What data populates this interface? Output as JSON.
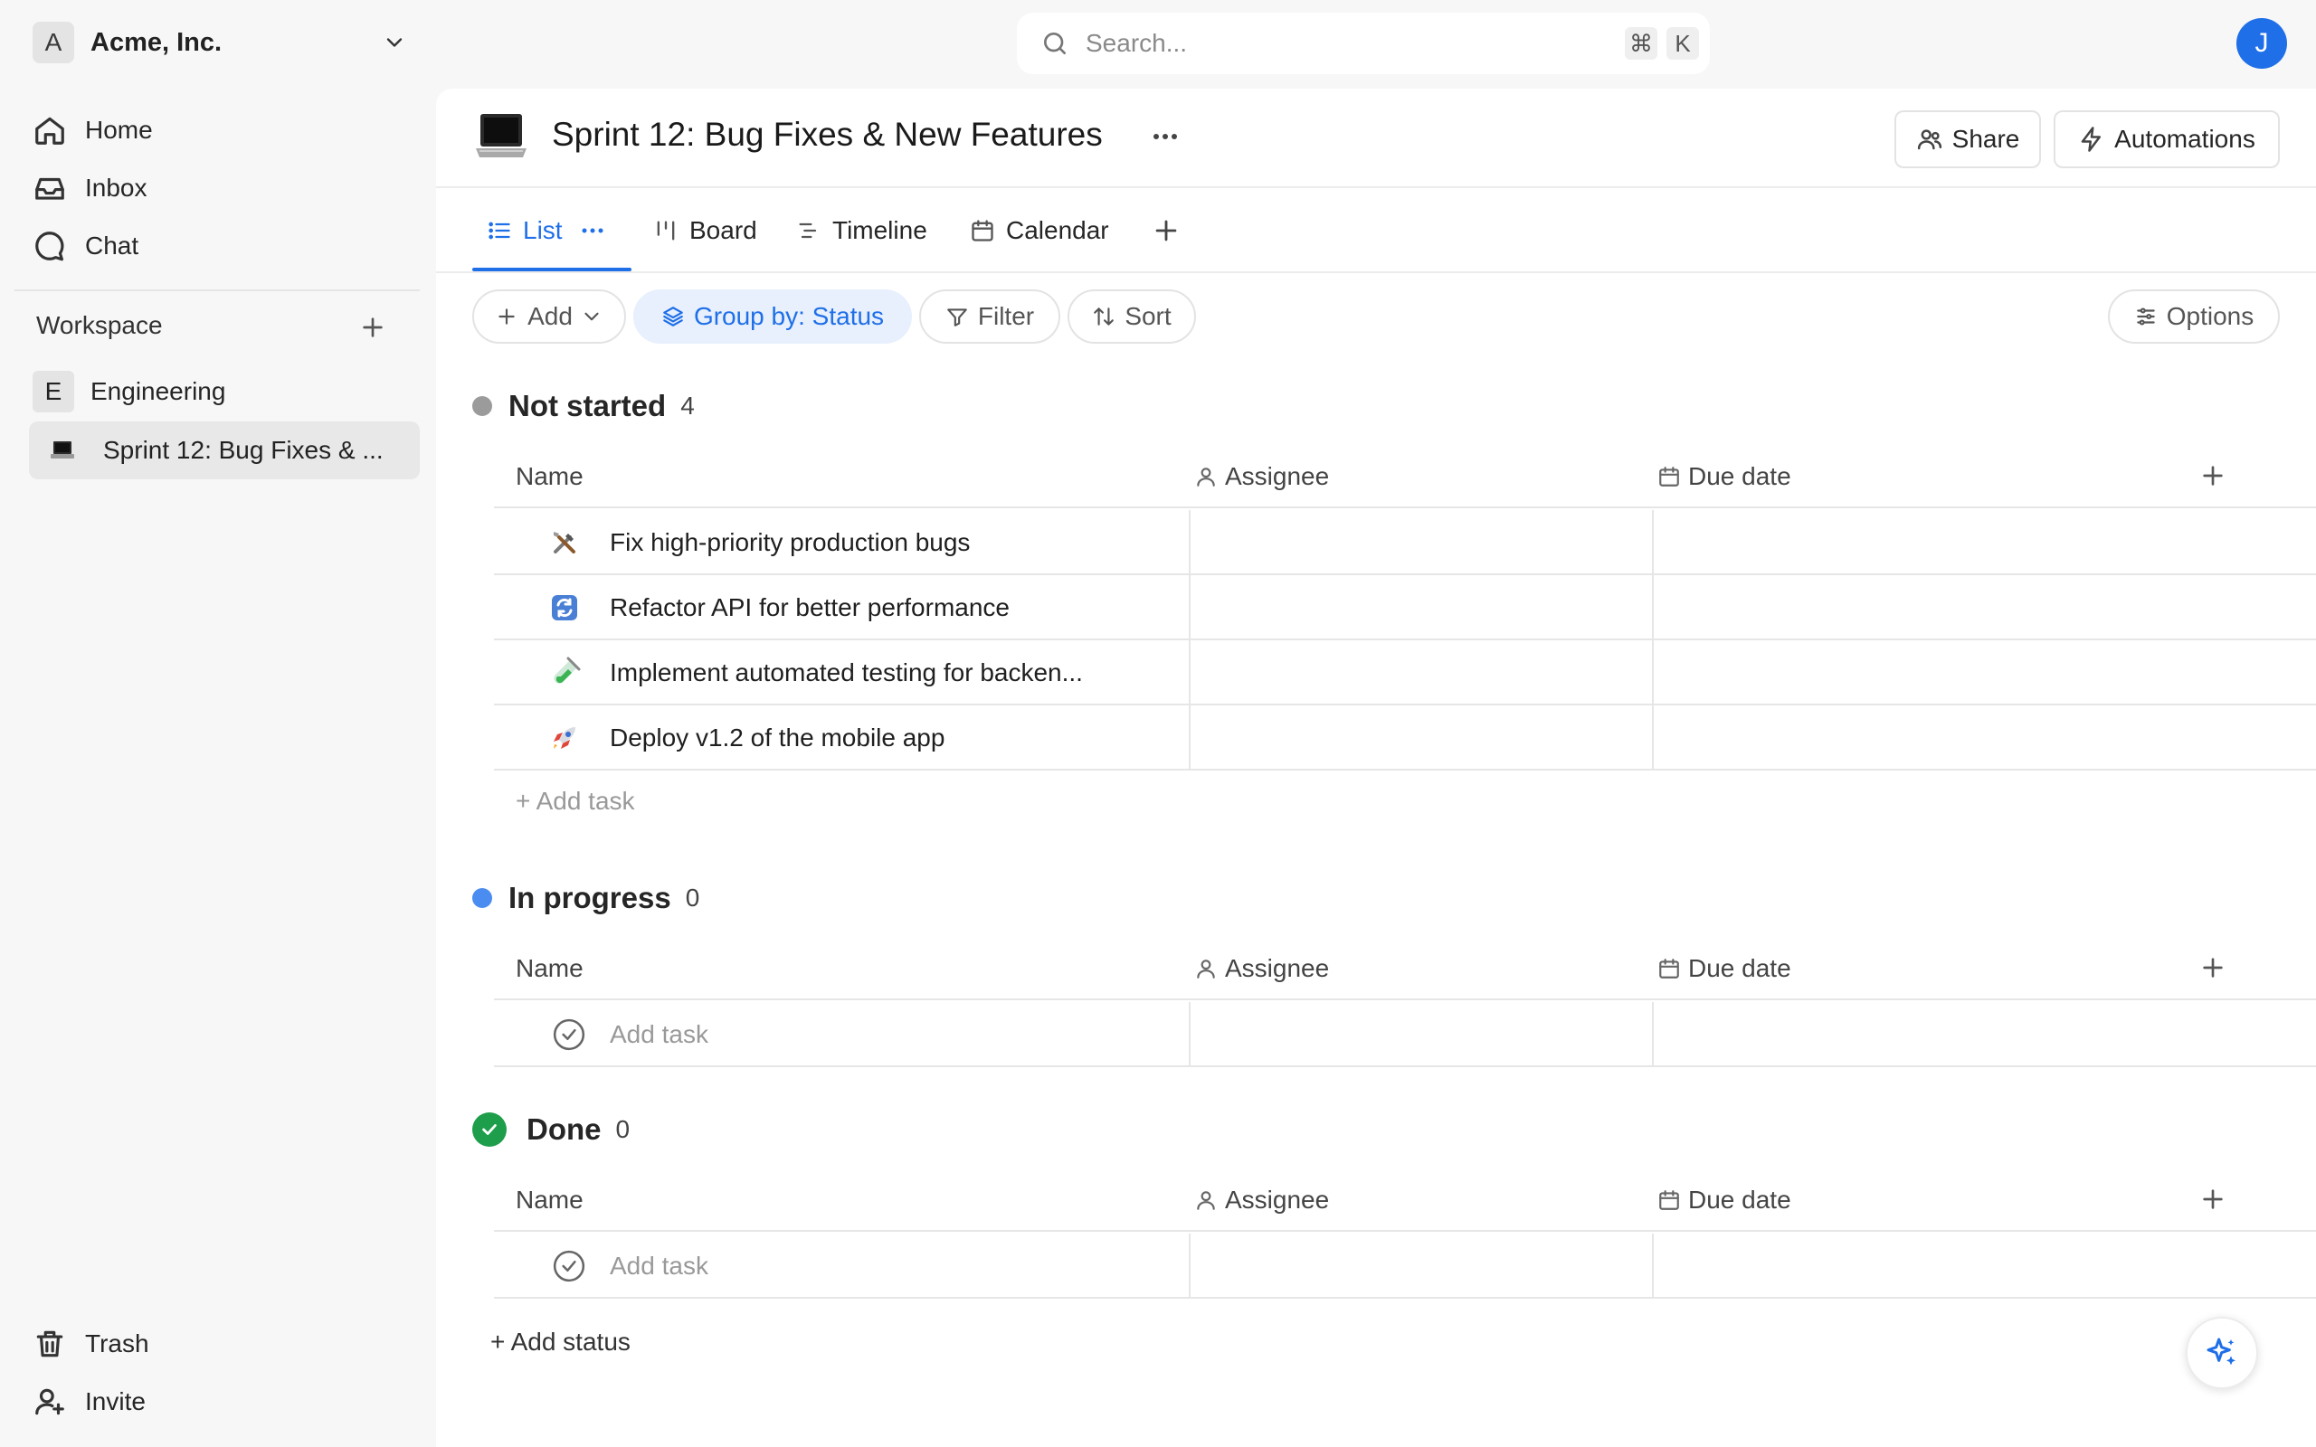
{
  "org": {
    "initial": "A",
    "name": "Acme, Inc."
  },
  "nav": [
    {
      "label": "Home",
      "icon": "home-icon"
    },
    {
      "label": "Inbox",
      "icon": "inbox-icon"
    },
    {
      "label": "Chat",
      "icon": "chat-icon"
    }
  ],
  "workspace": {
    "label": "Workspace",
    "team": {
      "initial": "E",
      "name": "Engineering"
    },
    "project": "Sprint 12: Bug Fixes & ..."
  },
  "sidebar_bottom": {
    "trash": "Trash",
    "invite": "Invite"
  },
  "search": {
    "placeholder": "Search...",
    "shortcut_cmd": "⌘",
    "shortcut_key": "K"
  },
  "user": {
    "initial": "J"
  },
  "page": {
    "title": "Sprint 12: Bug Fixes & New Features",
    "share": "Share",
    "automations": "Automations"
  },
  "tabs": [
    {
      "label": "List",
      "active": true
    },
    {
      "label": "Board"
    },
    {
      "label": "Timeline"
    },
    {
      "label": "Calendar"
    }
  ],
  "toolbar": {
    "add": "Add",
    "group_by": "Group by: Status",
    "filter": "Filter",
    "sort": "Sort",
    "options": "Options"
  },
  "columns": {
    "name": "Name",
    "assignee": "Assignee",
    "due_date": "Due date"
  },
  "groups": [
    {
      "status": "Not started",
      "count": "4",
      "color": "#9b9b9b",
      "tasks": [
        {
          "emoji": "hammer-wrench-icon",
          "name": "Fix high-priority production bugs"
        },
        {
          "emoji": "refresh-icon",
          "name": "Refactor API for better performance"
        },
        {
          "emoji": "test-tube-icon",
          "name": "Implement automated testing for backen..."
        },
        {
          "emoji": "rocket-icon",
          "name": "Deploy v1.2 of the mobile app"
        }
      ],
      "add_task": "+ Add task"
    },
    {
      "status": "In progress",
      "count": "0",
      "color": "#4a8cf0",
      "add_task": "Add task"
    },
    {
      "status": "Done",
      "count": "0",
      "color": "#1e9e4a",
      "add_task": "Add task"
    }
  ],
  "add_status": "+ Add status",
  "colors": {
    "accent": "#1f6fe8",
    "done": "#1e9e4a"
  }
}
